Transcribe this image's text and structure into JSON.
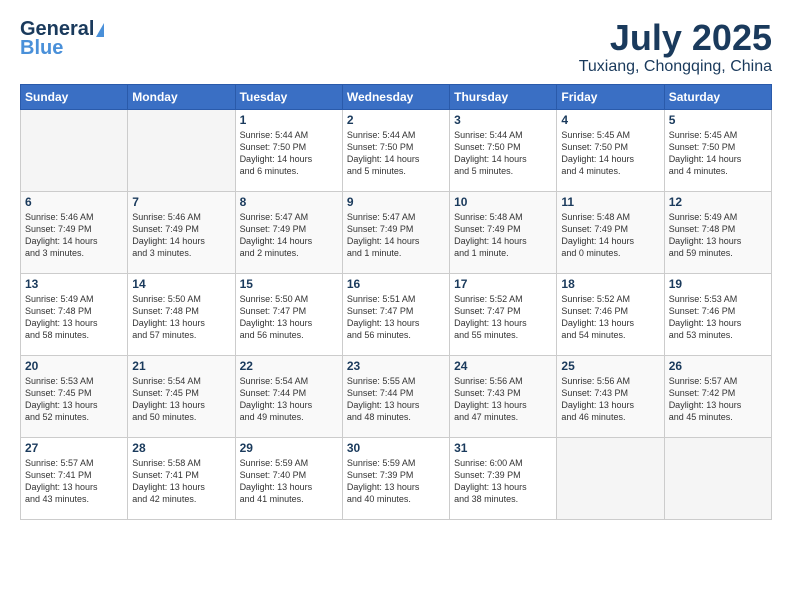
{
  "header": {
    "logo_line1": "General",
    "logo_line2": "Blue",
    "month": "July 2025",
    "location": "Tuxiang, Chongqing, China"
  },
  "weekdays": [
    "Sunday",
    "Monday",
    "Tuesday",
    "Wednesday",
    "Thursday",
    "Friday",
    "Saturday"
  ],
  "weeks": [
    [
      {
        "day": "",
        "info": ""
      },
      {
        "day": "",
        "info": ""
      },
      {
        "day": "1",
        "info": "Sunrise: 5:44 AM\nSunset: 7:50 PM\nDaylight: 14 hours\nand 6 minutes."
      },
      {
        "day": "2",
        "info": "Sunrise: 5:44 AM\nSunset: 7:50 PM\nDaylight: 14 hours\nand 5 minutes."
      },
      {
        "day": "3",
        "info": "Sunrise: 5:44 AM\nSunset: 7:50 PM\nDaylight: 14 hours\nand 5 minutes."
      },
      {
        "day": "4",
        "info": "Sunrise: 5:45 AM\nSunset: 7:50 PM\nDaylight: 14 hours\nand 4 minutes."
      },
      {
        "day": "5",
        "info": "Sunrise: 5:45 AM\nSunset: 7:50 PM\nDaylight: 14 hours\nand 4 minutes."
      }
    ],
    [
      {
        "day": "6",
        "info": "Sunrise: 5:46 AM\nSunset: 7:49 PM\nDaylight: 14 hours\nand 3 minutes."
      },
      {
        "day": "7",
        "info": "Sunrise: 5:46 AM\nSunset: 7:49 PM\nDaylight: 14 hours\nand 3 minutes."
      },
      {
        "day": "8",
        "info": "Sunrise: 5:47 AM\nSunset: 7:49 PM\nDaylight: 14 hours\nand 2 minutes."
      },
      {
        "day": "9",
        "info": "Sunrise: 5:47 AM\nSunset: 7:49 PM\nDaylight: 14 hours\nand 1 minute."
      },
      {
        "day": "10",
        "info": "Sunrise: 5:48 AM\nSunset: 7:49 PM\nDaylight: 14 hours\nand 1 minute."
      },
      {
        "day": "11",
        "info": "Sunrise: 5:48 AM\nSunset: 7:49 PM\nDaylight: 14 hours\nand 0 minutes."
      },
      {
        "day": "12",
        "info": "Sunrise: 5:49 AM\nSunset: 7:48 PM\nDaylight: 13 hours\nand 59 minutes."
      }
    ],
    [
      {
        "day": "13",
        "info": "Sunrise: 5:49 AM\nSunset: 7:48 PM\nDaylight: 13 hours\nand 58 minutes."
      },
      {
        "day": "14",
        "info": "Sunrise: 5:50 AM\nSunset: 7:48 PM\nDaylight: 13 hours\nand 57 minutes."
      },
      {
        "day": "15",
        "info": "Sunrise: 5:50 AM\nSunset: 7:47 PM\nDaylight: 13 hours\nand 56 minutes."
      },
      {
        "day": "16",
        "info": "Sunrise: 5:51 AM\nSunset: 7:47 PM\nDaylight: 13 hours\nand 56 minutes."
      },
      {
        "day": "17",
        "info": "Sunrise: 5:52 AM\nSunset: 7:47 PM\nDaylight: 13 hours\nand 55 minutes."
      },
      {
        "day": "18",
        "info": "Sunrise: 5:52 AM\nSunset: 7:46 PM\nDaylight: 13 hours\nand 54 minutes."
      },
      {
        "day": "19",
        "info": "Sunrise: 5:53 AM\nSunset: 7:46 PM\nDaylight: 13 hours\nand 53 minutes."
      }
    ],
    [
      {
        "day": "20",
        "info": "Sunrise: 5:53 AM\nSunset: 7:45 PM\nDaylight: 13 hours\nand 52 minutes."
      },
      {
        "day": "21",
        "info": "Sunrise: 5:54 AM\nSunset: 7:45 PM\nDaylight: 13 hours\nand 50 minutes."
      },
      {
        "day": "22",
        "info": "Sunrise: 5:54 AM\nSunset: 7:44 PM\nDaylight: 13 hours\nand 49 minutes."
      },
      {
        "day": "23",
        "info": "Sunrise: 5:55 AM\nSunset: 7:44 PM\nDaylight: 13 hours\nand 48 minutes."
      },
      {
        "day": "24",
        "info": "Sunrise: 5:56 AM\nSunset: 7:43 PM\nDaylight: 13 hours\nand 47 minutes."
      },
      {
        "day": "25",
        "info": "Sunrise: 5:56 AM\nSunset: 7:43 PM\nDaylight: 13 hours\nand 46 minutes."
      },
      {
        "day": "26",
        "info": "Sunrise: 5:57 AM\nSunset: 7:42 PM\nDaylight: 13 hours\nand 45 minutes."
      }
    ],
    [
      {
        "day": "27",
        "info": "Sunrise: 5:57 AM\nSunset: 7:41 PM\nDaylight: 13 hours\nand 43 minutes."
      },
      {
        "day": "28",
        "info": "Sunrise: 5:58 AM\nSunset: 7:41 PM\nDaylight: 13 hours\nand 42 minutes."
      },
      {
        "day": "29",
        "info": "Sunrise: 5:59 AM\nSunset: 7:40 PM\nDaylight: 13 hours\nand 41 minutes."
      },
      {
        "day": "30",
        "info": "Sunrise: 5:59 AM\nSunset: 7:39 PM\nDaylight: 13 hours\nand 40 minutes."
      },
      {
        "day": "31",
        "info": "Sunrise: 6:00 AM\nSunset: 7:39 PM\nDaylight: 13 hours\nand 38 minutes."
      },
      {
        "day": "",
        "info": ""
      },
      {
        "day": "",
        "info": ""
      }
    ]
  ]
}
